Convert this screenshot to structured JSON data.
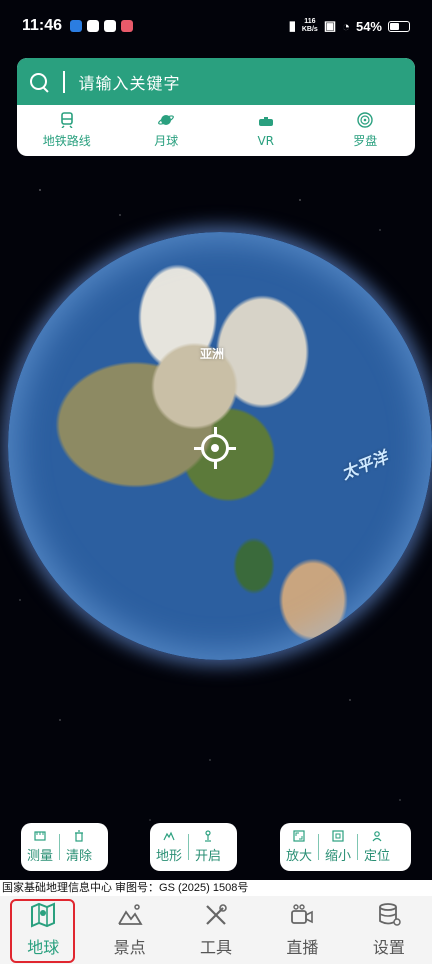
{
  "status_bar": {
    "time": "11:46",
    "net_speed_value": "116",
    "net_speed_unit": "KB/s",
    "battery": "54%"
  },
  "search": {
    "placeholder": "请输入关键字"
  },
  "quick_links": [
    {
      "label": "地铁路线",
      "icon": "metro-icon"
    },
    {
      "label": "月球",
      "icon": "planet-icon"
    },
    {
      "label": "VR",
      "icon": "vr-icon"
    },
    {
      "label": "罗盘",
      "icon": "compass-icon"
    }
  ],
  "globe": {
    "continent_label": "亚洲",
    "ocean_label": "太平洋"
  },
  "tools": {
    "measure": "测量",
    "clear": "清除",
    "terrain": "地形",
    "open": "开启",
    "zoom_in": "放大",
    "zoom_out": "缩小",
    "locate": "定位"
  },
  "credit": "国家基础地理信息中心  审图号：GS (2025) 1508号",
  "nav": [
    {
      "label": "地球",
      "active": true
    },
    {
      "label": "景点",
      "active": false
    },
    {
      "label": "工具",
      "active": false
    },
    {
      "label": "直播",
      "active": false
    },
    {
      "label": "设置",
      "active": false
    }
  ],
  "colors": {
    "accent": "#2aa07f",
    "highlight": "#e0262f"
  }
}
